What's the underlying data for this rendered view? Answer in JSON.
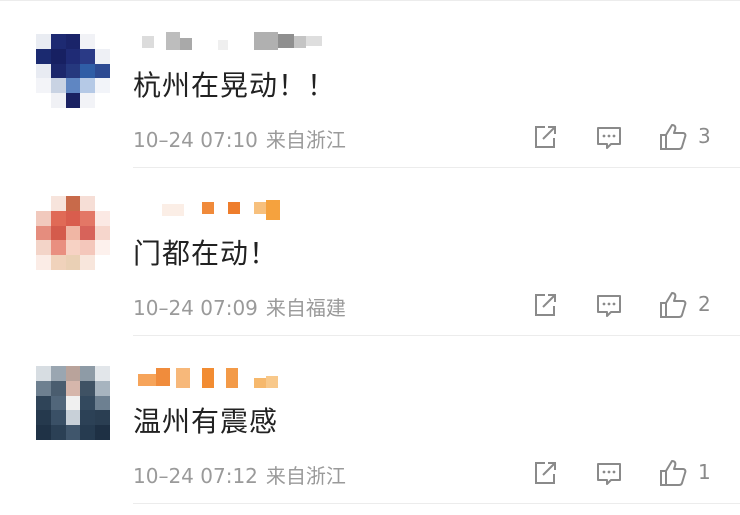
{
  "comments": [
    {
      "text": "杭州在晃动！！",
      "time": "10–24 07:10",
      "source": "来自浙江",
      "likes": "3"
    },
    {
      "text": "门都在动！",
      "time": "10–24 07:09",
      "source": "来自福建",
      "likes": "2"
    },
    {
      "text": "温州有震感",
      "time": "10–24 07:12",
      "source": "来自浙江",
      "likes": "1"
    }
  ],
  "icons": {
    "share": "share-icon",
    "comment": "comment-icon",
    "like": "thumbs-up-icon"
  },
  "colors": {
    "text": "#222222",
    "meta": "#9a9a9a",
    "icon": "#8a8a8a",
    "divider": "#ececec"
  }
}
